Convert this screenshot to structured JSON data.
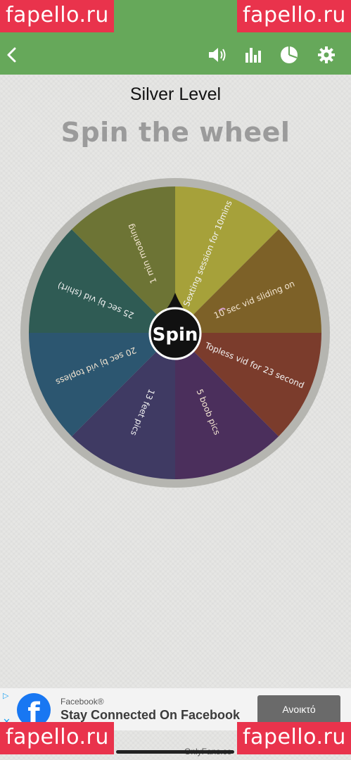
{
  "watermark": {
    "text": "fapello.ru"
  },
  "toolbar": {
    "icons": [
      "back-icon",
      "sound-icon",
      "stats-icon",
      "pie-chart-icon",
      "gear-icon"
    ]
  },
  "header": {
    "level": "Silver Level",
    "title": "Spin the wheel"
  },
  "wheel": {
    "spin_label": "Spin",
    "segments": [
      {
        "label": "Sexting session for 10mins",
        "color": "#a6a13a"
      },
      {
        "label": "10 sec vid sliding on",
        "color": "#7d6128"
      },
      {
        "label": "Topless vid for 23 second",
        "color": "#7b3c2c"
      },
      {
        "label": "5 boob pics",
        "color": "#4b2f5c"
      },
      {
        "label": "13 feet pics",
        "color": "#3f3a63"
      },
      {
        "label": "20 sec bj vid topless",
        "color": "#2c5670"
      },
      {
        "label": "25 sec bj vid (shirt)",
        "color": "#2f5b54"
      },
      {
        "label": "1 min moaning",
        "color": "#6d7435"
      }
    ]
  },
  "ad": {
    "sponsor": "Facebook®",
    "headline": "Stay Connected On Facebook",
    "cta": "Ανοικτό"
  },
  "footer": {
    "text": "OnlyFans.co"
  }
}
